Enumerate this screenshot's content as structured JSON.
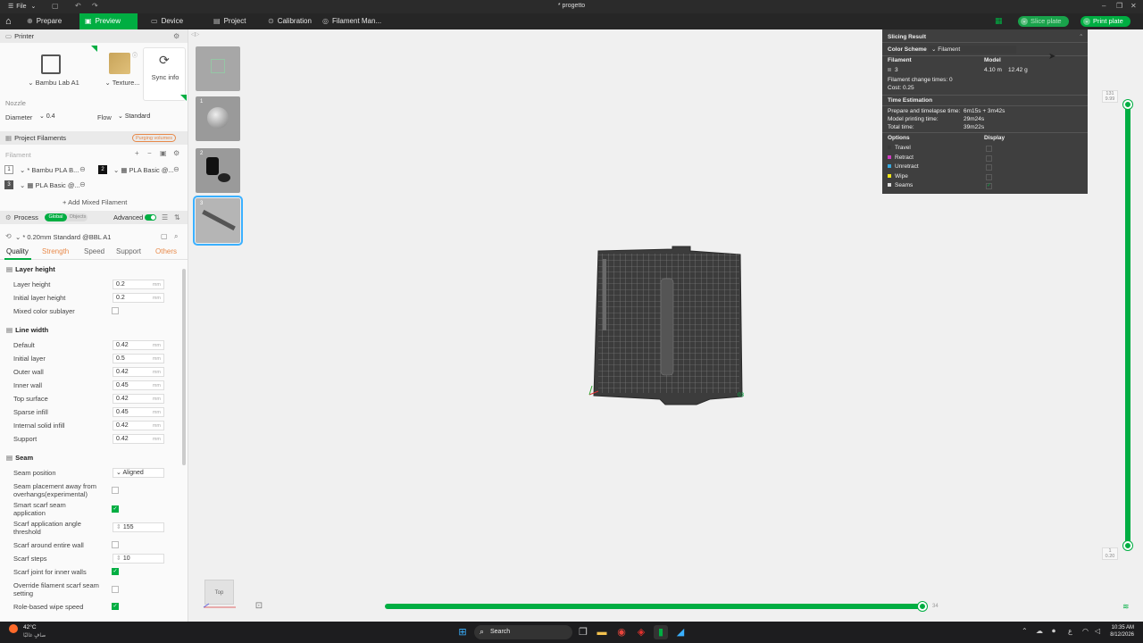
{
  "titlebar": {
    "menu_label": "File",
    "doc_title": "* progetto"
  },
  "nav": {
    "tabs": [
      {
        "label": "Prepare",
        "active": false
      },
      {
        "label": "Preview",
        "active": true
      },
      {
        "label": "Device",
        "active": false
      },
      {
        "label": "Project",
        "active": false
      },
      {
        "label": "Calibration",
        "active": false
      },
      {
        "label": "Filament Man...",
        "active": false
      }
    ],
    "slice_label": "Slice plate",
    "print_label": "Print plate"
  },
  "printer": {
    "section_label": "Printer",
    "printer_name": "Bambu Lab A1",
    "plate_label": "Texture...",
    "sync_label": "Sync info",
    "nozzle_label": "Nozzle",
    "diameter_label": "Diameter",
    "diameter_value": "0.4",
    "flow_label": "Flow",
    "flow_value": "Standard"
  },
  "filaments": {
    "section_label": "Project Filaments",
    "purge_label": "Purging volumes",
    "list_label": "Filament",
    "items": [
      {
        "index": "1",
        "name": "* Bambu PLA B...",
        "color": "#ffffff"
      },
      {
        "index": "2",
        "name": "PLA Basic @...",
        "color": "#111111"
      },
      {
        "index": "3",
        "name": "PLA Basic @...",
        "color": "#555555"
      }
    ],
    "add_mixed_label": "Add Mixed Filament"
  },
  "process": {
    "section_label": "Process",
    "global_label": "Global",
    "objects_label": "Objects",
    "advanced_label": "Advanced",
    "preset_label": "* 0.20mm Standard @BBL A1",
    "tabs": [
      {
        "label": "Quality",
        "active": true,
        "warn": false
      },
      {
        "label": "Strength",
        "active": false,
        "warn": true
      },
      {
        "label": "Speed",
        "active": false,
        "warn": false
      },
      {
        "label": "Support",
        "active": false,
        "warn": false
      },
      {
        "label": "Others",
        "active": false,
        "warn": true
      }
    ],
    "unit_mm": "mm",
    "layer_height": {
      "title": "Layer height",
      "layer_height_label": "Layer height",
      "layer_height_value": "0.2",
      "initial_layer_height_label": "Initial layer height",
      "initial_layer_height_value": "0.2",
      "mixed_color_label": "Mixed color sublayer"
    },
    "line_width": {
      "title": "Line width",
      "rows": [
        {
          "label": "Default",
          "value": "0.42"
        },
        {
          "label": "Initial layer",
          "value": "0.5"
        },
        {
          "label": "Outer wall",
          "value": "0.42"
        },
        {
          "label": "Inner wall",
          "value": "0.45"
        },
        {
          "label": "Top surface",
          "value": "0.42"
        },
        {
          "label": "Sparse infill",
          "value": "0.45"
        },
        {
          "label": "Internal solid infill",
          "value": "0.42"
        },
        {
          "label": "Support",
          "value": "0.42"
        }
      ]
    },
    "seam": {
      "title": "Seam",
      "seam_position_label": "Seam position",
      "seam_position_value": "Aligned",
      "overhang_label_1": "Seam placement away from",
      "overhang_label_2": "overhangs(experimental)",
      "smart_scarf_label_1": "Smart scarf seam",
      "smart_scarf_label_2": "application",
      "scarf_angle_label_1": "Scarf application angle",
      "scarf_angle_label_2": "threshold",
      "scarf_angle_value": "155",
      "scarf_entire_wall_label": "Scarf around entire wall",
      "scarf_steps_label": "Scarf steps",
      "scarf_steps_value": "10",
      "scarf_inner_label": "Scarf joint for inner walls",
      "override_label_1": "Override filament scarf seam",
      "override_label_2": "setting",
      "role_wipe_label": "Role-based wipe speed"
    }
  },
  "plates": [
    {
      "number": ""
    },
    {
      "number": "1"
    },
    {
      "number": "2"
    },
    {
      "number": "3"
    }
  ],
  "slicing_result": {
    "title": "Slicing Result",
    "color_scheme_label": "Color Scheme",
    "color_scheme_value": "Filament",
    "filament_col": "Filament",
    "model_col": "Model",
    "filament_id": "3",
    "length": "4.10 m",
    "weight": "12.42 g",
    "change_times": "Filament change times:  0",
    "cost": "Cost:  0.25",
    "time_title": "Time Estimation",
    "prepare_label": "Prepare and timelapse time:",
    "prepare_value": "6m15s + 3m42s",
    "model_time_label": "Model printing time:",
    "model_time_value": "29m24s",
    "total_label": "Total time:",
    "total_value": "39m22s",
    "options_label": "Options",
    "display_label": "Display",
    "options": [
      {
        "label": "Travel",
        "color": "#3a3a3a",
        "checked": false
      },
      {
        "label": "Retract",
        "color": "#d23cc3",
        "checked": false
      },
      {
        "label": "Unretract",
        "color": "#36a9e0",
        "checked": false
      },
      {
        "label": "Wipe",
        "color": "#f2e618",
        "checked": false
      },
      {
        "label": "Seams",
        "color": "#dddddd",
        "checked": true
      }
    ]
  },
  "canvas": {
    "plate_label": "03",
    "view_cube_label": "Top",
    "layer_top": "131\n9.99",
    "layer_bottom": "1\n0.20",
    "progress_end": "34",
    "progress_fraction": 0.995
  },
  "taskbar": {
    "weather_temp": "42°C",
    "weather_text": "صافٍ غالبًا",
    "search_label": "Search",
    "time": "10:35 AM",
    "date": "8/12/2026"
  },
  "colors": {
    "accent": "#00ae42",
    "dark": "#262626",
    "warn": "#e88a4a"
  }
}
